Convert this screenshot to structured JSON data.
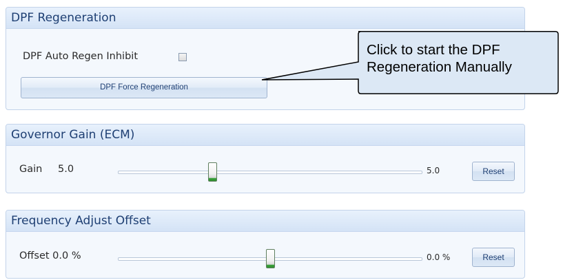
{
  "dpf_section": {
    "title": "DPF Regeneration",
    "auto_regen_inhibit_label": "DPF Auto Regen Inhibit",
    "auto_regen_inhibit_checked": false,
    "force_regen_button": "DPF Force Regeneration"
  },
  "callout": {
    "line1": "Click to start the DPF",
    "line2": "Regeneration Manually"
  },
  "governor_section": {
    "title": "Governor Gain (ECM)",
    "label": "Gain",
    "value": "5.0",
    "slider_value_text": "5.0",
    "slider_fraction": 0.31,
    "reset_button": "Reset"
  },
  "frequency_section": {
    "title": "Frequency Adjust Offset",
    "label": "Offset 0.0 %",
    "slider_value_text": "0.0 %",
    "slider_fraction": 0.5,
    "reset_button": "Reset"
  },
  "colors": {
    "header_text": "#1e3f73",
    "panel_border": "#c2d3ea",
    "thumb_accent": "#3aa23a"
  }
}
